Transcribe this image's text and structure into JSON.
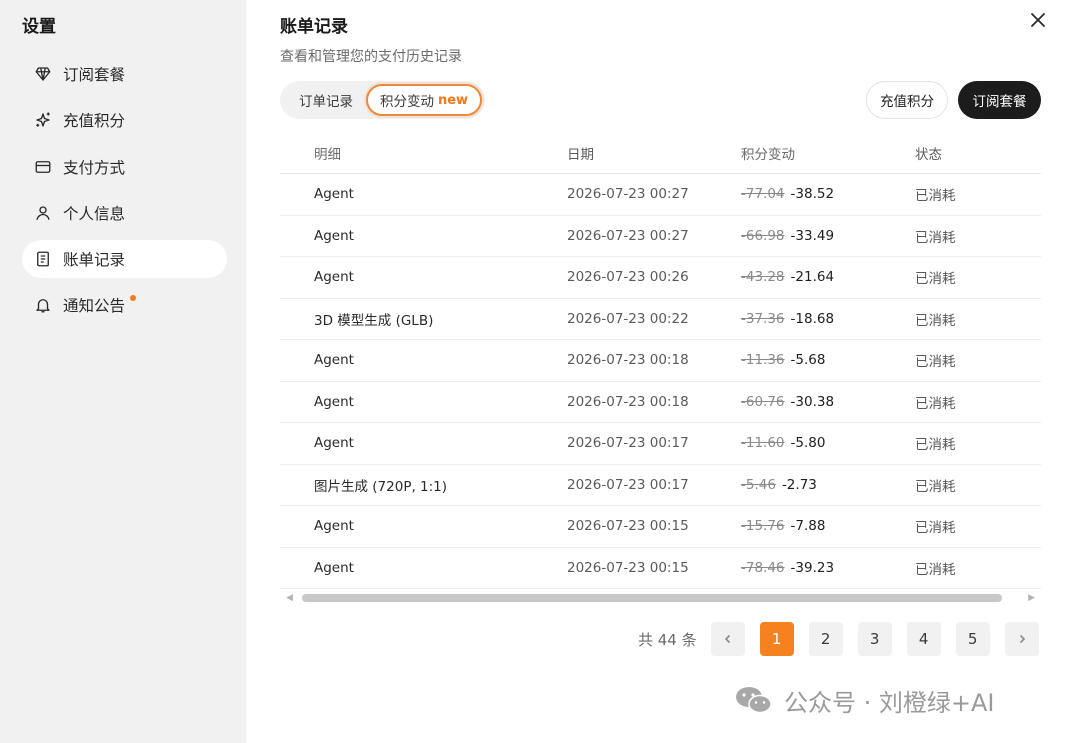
{
  "sidebar": {
    "title": "设置",
    "items": [
      {
        "label": "订阅套餐",
        "icon": "diamond-icon"
      },
      {
        "label": "充值积分",
        "icon": "sparkle-icon"
      },
      {
        "label": "支付方式",
        "icon": "credit-card-icon"
      },
      {
        "label": "个人信息",
        "icon": "user-icon"
      },
      {
        "label": "账单记录",
        "icon": "receipt-icon",
        "active": true
      },
      {
        "label": "通知公告",
        "icon": "bell-icon",
        "has_dot": true
      }
    ]
  },
  "main": {
    "title": "账单记录",
    "subtitle": "查看和管理您的支付历史记录",
    "tabs": [
      {
        "label": "订单记录"
      },
      {
        "label": "积分变动",
        "badge": "new",
        "active": true
      }
    ],
    "actions": {
      "recharge_label": "充值积分",
      "subscribe_label": "订阅套餐"
    },
    "table": {
      "columns": [
        "明细",
        "日期",
        "积分变动",
        "状态"
      ],
      "rows": [
        {
          "detail": "Agent",
          "date": "2026-07-23 00:27",
          "original": "-77.04",
          "final": "-38.52",
          "status": "已消耗"
        },
        {
          "detail": "Agent",
          "date": "2026-07-23 00:27",
          "original": "-66.98",
          "final": "-33.49",
          "status": "已消耗"
        },
        {
          "detail": "Agent",
          "date": "2026-07-23 00:26",
          "original": "-43.28",
          "final": "-21.64",
          "status": "已消耗"
        },
        {
          "detail": "3D 模型生成 (GLB)",
          "date": "2026-07-23 00:22",
          "original": "-37.36",
          "final": "-18.68",
          "status": "已消耗"
        },
        {
          "detail": "Agent",
          "date": "2026-07-23 00:18",
          "original": "-11.36",
          "final": "-5.68",
          "status": "已消耗"
        },
        {
          "detail": "Agent",
          "date": "2026-07-23 00:18",
          "original": "-60.76",
          "final": "-30.38",
          "status": "已消耗"
        },
        {
          "detail": "Agent",
          "date": "2026-07-23 00:17",
          "original": "-11.60",
          "final": "-5.80",
          "status": "已消耗"
        },
        {
          "detail": "图片生成 (720P, 1:1)",
          "date": "2026-07-23 00:17",
          "original": "-5.46",
          "final": "-2.73",
          "status": "已消耗"
        },
        {
          "detail": "Agent",
          "date": "2026-07-23 00:15",
          "original": "-15.76",
          "final": "-7.88",
          "status": "已消耗"
        },
        {
          "detail": "Agent",
          "date": "2026-07-23 00:15",
          "original": "-78.46",
          "final": "-39.23",
          "status": "已消耗"
        }
      ]
    },
    "pagination": {
      "total_text": "共 44 条",
      "pages": [
        "1",
        "2",
        "3",
        "4",
        "5"
      ],
      "current": "1",
      "prev_icon": "chevron-left-icon",
      "next_icon": "chevron-right-icon"
    }
  },
  "watermark": {
    "text": "公众号 · 刘橙绿+AI",
    "icon": "wechat-icon"
  },
  "colors": {
    "accent": "#f5821f",
    "primary_button": "#1c1c1c",
    "sidebar_bg": "#f1f1f1"
  }
}
